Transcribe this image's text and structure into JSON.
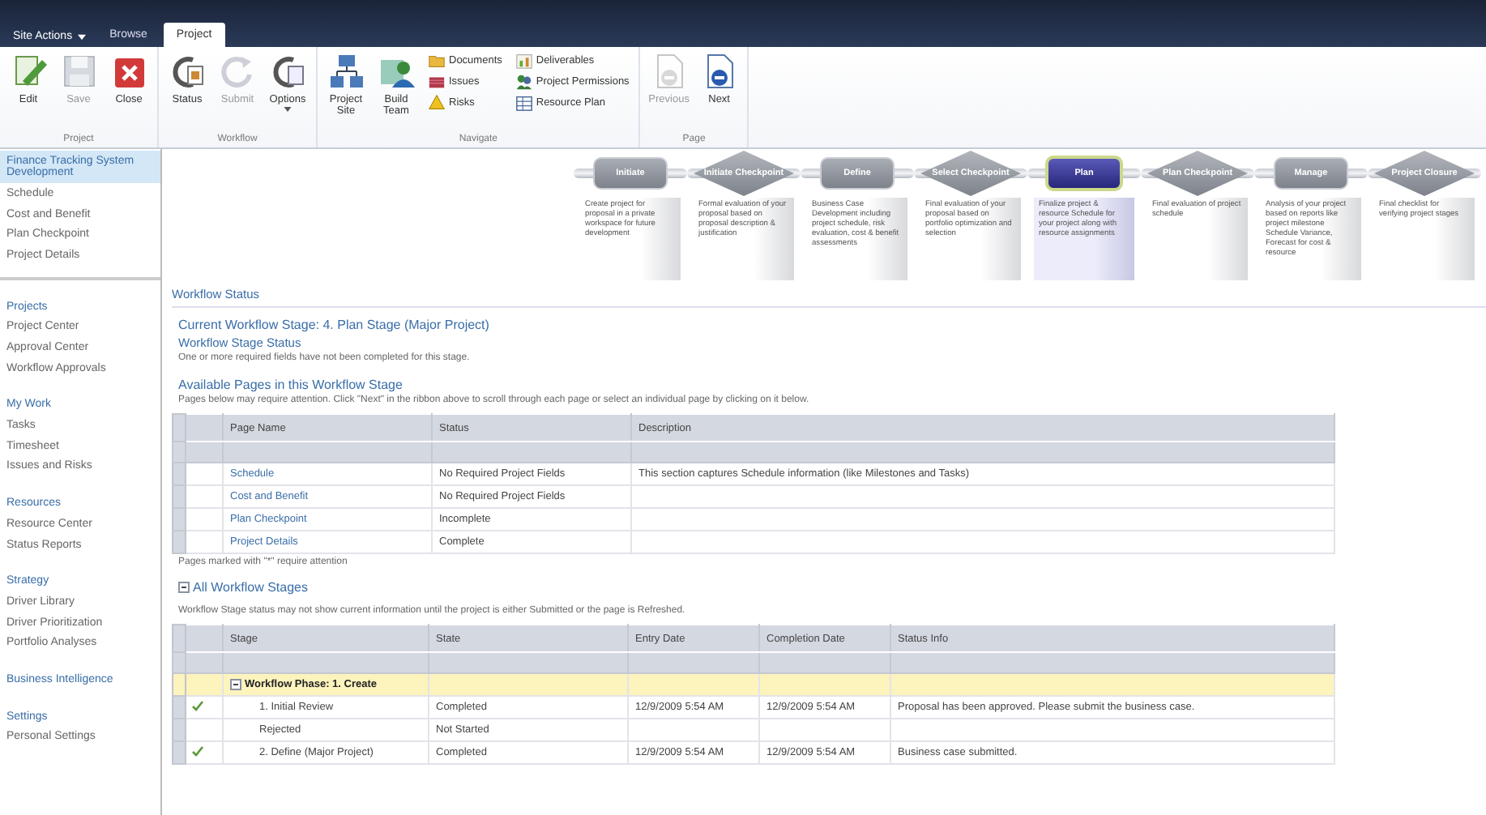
{
  "top_bar": {
    "site_actions": "Site Actions",
    "tabs": [
      {
        "label": "Browse",
        "selected": false
      },
      {
        "label": "Project",
        "selected": true
      }
    ]
  },
  "ribbon": {
    "groups": [
      {
        "label": "Project",
        "columns": [
          [
            {
              "kind": "large",
              "label": "Edit",
              "disabled": false
            }
          ],
          [
            {
              "kind": "large",
              "label": "Save",
              "disabled": true
            }
          ],
          [
            {
              "kind": "large",
              "label": "Close",
              "disabled": false
            }
          ]
        ]
      },
      {
        "label": "Workflow",
        "columns": [
          [
            {
              "kind": "large",
              "label": "Status",
              "disabled": false
            }
          ],
          [
            {
              "kind": "large",
              "label": "Submit",
              "disabled": true
            }
          ],
          [
            {
              "kind": "large",
              "label": "Options",
              "disabled": false,
              "dropdown": true
            }
          ]
        ]
      },
      {
        "label": "Navigate",
        "columns": [
          [
            {
              "kind": "large",
              "label": "Project Site",
              "disabled": false
            }
          ],
          [
            {
              "kind": "large",
              "label": "Build Team",
              "disabled": false
            }
          ],
          [
            {
              "kind": "small",
              "label": "Documents",
              "disabled": false
            },
            {
              "kind": "small",
              "label": "Issues",
              "disabled": false
            },
            {
              "kind": "small",
              "label": "Risks",
              "disabled": false
            }
          ],
          [
            {
              "kind": "small",
              "label": "Deliverables",
              "disabled": false
            },
            {
              "kind": "small",
              "label": "Project Permissions",
              "disabled": false
            },
            {
              "kind": "small",
              "label": "Resource Plan",
              "disabled": false
            }
          ]
        ]
      },
      {
        "label": "Page",
        "columns": [
          [
            {
              "kind": "large",
              "label": "Previous",
              "disabled": true
            }
          ],
          [
            {
              "kind": "large",
              "label": "Next",
              "disabled": false
            }
          ]
        ]
      }
    ]
  },
  "sidebar": {
    "project_links": [
      {
        "label": "Finance Tracking System Development",
        "selected": true
      },
      {
        "label": "Schedule",
        "selected": false
      },
      {
        "label": "Cost and Benefit",
        "selected": false
      },
      {
        "label": "Plan Checkpoint",
        "selected": false
      },
      {
        "label": "Project Details",
        "selected": false
      }
    ],
    "groups": [
      {
        "heading": "Projects",
        "items": [
          {
            "label": "Project Center",
            "selected": false
          },
          {
            "label": "Approval Center",
            "selected": false
          },
          {
            "label": "Workflow Approvals",
            "selected": false
          }
        ]
      },
      {
        "heading": "My Work",
        "items": [
          {
            "label": "Tasks",
            "selected": false
          },
          {
            "label": "Timesheet",
            "selected": false
          },
          {
            "label": "Issues and Risks",
            "selected": false
          }
        ]
      },
      {
        "heading": "Resources",
        "items": [
          {
            "label": "Resource Center",
            "selected": false
          },
          {
            "label": "Status Reports",
            "selected": false
          }
        ]
      },
      {
        "heading": "Strategy",
        "items": [
          {
            "label": "Driver Library",
            "selected": false
          },
          {
            "label": "Driver Prioritization",
            "selected": false
          },
          {
            "label": "Portfolio Analyses",
            "selected": false
          }
        ]
      },
      {
        "heading": "Business Intelligence"
      },
      {
        "heading": "Settings",
        "items": [
          {
            "label": "Personal Settings",
            "selected": false
          }
        ]
      }
    ]
  },
  "workflow_diagram": {
    "stages": [
      {
        "kind": "stage",
        "name": "Initiate",
        "selected": false,
        "description": "Create project for proposal in a private workspace for future development"
      },
      {
        "kind": "checkpoint",
        "name": "Initiate Checkpoint",
        "selected": false,
        "description": "Formal evaluation of your proposal based on proposal description & justification"
      },
      {
        "kind": "stage",
        "name": "Define",
        "selected": false,
        "description": "Business Case Development including project schedule, risk evaluation, cost & benefit assessments"
      },
      {
        "kind": "checkpoint",
        "name": "Select Checkpoint",
        "selected": false,
        "description": "Final evaluation of your proposal based on portfolio optimization and selection"
      },
      {
        "kind": "stage",
        "name": "Plan",
        "selected": true,
        "description": "Finalize project & resource Schedule for your project along with resource assignments"
      },
      {
        "kind": "checkpoint",
        "name": "Plan Checkpoint",
        "selected": false,
        "description": "Final evaluation of project schedule"
      },
      {
        "kind": "stage",
        "name": "Manage",
        "selected": false,
        "description": "Analysis of your project based on reports like project milestone Schedule Variance, Forecast for cost & resource"
      },
      {
        "kind": "checkpoint",
        "name": "Project Closure",
        "selected": false,
        "description": "Final checklist for verifying project stages"
      }
    ]
  },
  "workflow_status": {
    "title": "Workflow Status",
    "current_stage": "Current Workflow Stage: 4. Plan Stage (Major Project)",
    "stage_status_heading": "Workflow Stage Status",
    "stage_status": "One or more required fields have not been completed for this stage.",
    "pages_heading": "Available Pages in this Workflow Stage",
    "pages_hint": "Pages below may require attention. Click \"Next\" in the ribbon above to scroll through each page or select an individual page by clicking on it below.",
    "pages_table": {
      "columns": [
        "Page Name",
        "Status",
        "Description"
      ],
      "rows": [
        {
          "page_name": "Schedule",
          "status": "No Required Project Fields",
          "description": "This section captures Schedule information (like Milestones and Tasks)"
        },
        {
          "page_name": "Cost and Benefit",
          "status": "No Required Project Fields"
        },
        {
          "page_name": "Plan Checkpoint",
          "status": "Incomplete"
        },
        {
          "page_name": "Project Details",
          "status": "Complete"
        }
      ]
    },
    "pages_note": "Pages marked with \"*\" require attention",
    "all_stages": {
      "label": "All Workflow Stages",
      "expanded": true
    },
    "stages_note": "Workflow Stage status may not show current information until the project is either Submitted or the page is Refreshed.",
    "stages_table": {
      "columns": [
        "Stage",
        "State",
        "Entry Date",
        "Completion Date",
        "Status Info"
      ],
      "rows": [
        {
          "kind": "phase",
          "stage": "Workflow Phase: 1. Create",
          "expanded": true
        },
        {
          "kind": "stage",
          "completed": true,
          "stage": "1. Initial Review",
          "state": "Completed",
          "entry_date": "12/9/2009 5:54 AM",
          "completion_date": "12/9/2009 5:54 AM",
          "status_info": "Proposal has been approved. Please submit the business case."
        },
        {
          "kind": "stage",
          "completed": false,
          "stage": "Rejected",
          "state": "Not Started"
        },
        {
          "kind": "stage",
          "completed": true,
          "stage": "2. Define (Major Project)",
          "state": "Completed",
          "entry_date": "12/9/2009 5:54 AM",
          "completion_date": "12/9/2009 5:54 AM",
          "status_info": "Business case submitted."
        }
      ]
    }
  }
}
